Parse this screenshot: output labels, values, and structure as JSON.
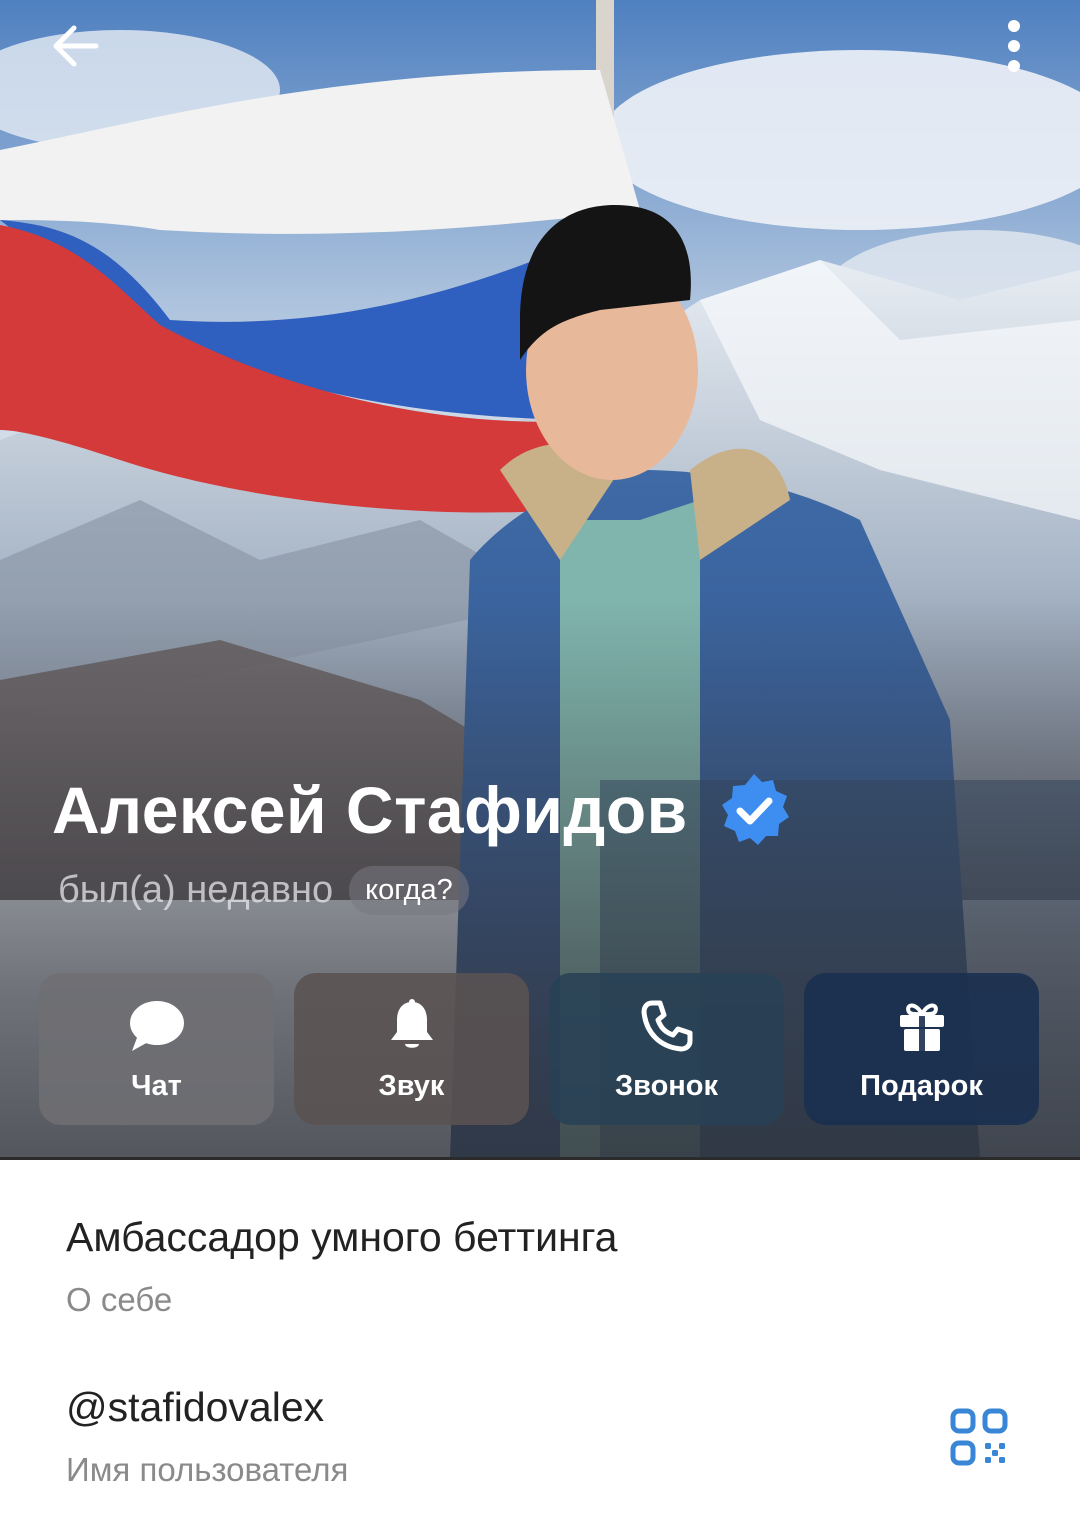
{
  "profile": {
    "name": "Алексей Стафидов",
    "status": "был(а) недавно",
    "status_chip": "когда?"
  },
  "actions": [
    {
      "label": "Чат",
      "icon": "chat-bubble-icon"
    },
    {
      "label": "Звук",
      "icon": "bell-icon"
    },
    {
      "label": "Звонок",
      "icon": "phone-icon"
    },
    {
      "label": "Подарок",
      "icon": "gift-icon"
    }
  ],
  "info": {
    "bio": {
      "value": "Амбассадор умного беттинга",
      "label": "О себе"
    },
    "username": {
      "value": "@stafidovalex",
      "label": "Имя пользователя"
    }
  },
  "colors": {
    "verified_badge": "#3d8ef0",
    "qr_accent": "#3a86d6",
    "flag_white": "#f2f2f2",
    "flag_blue": "#2f5fbf",
    "flag_red": "#d43a3a"
  }
}
